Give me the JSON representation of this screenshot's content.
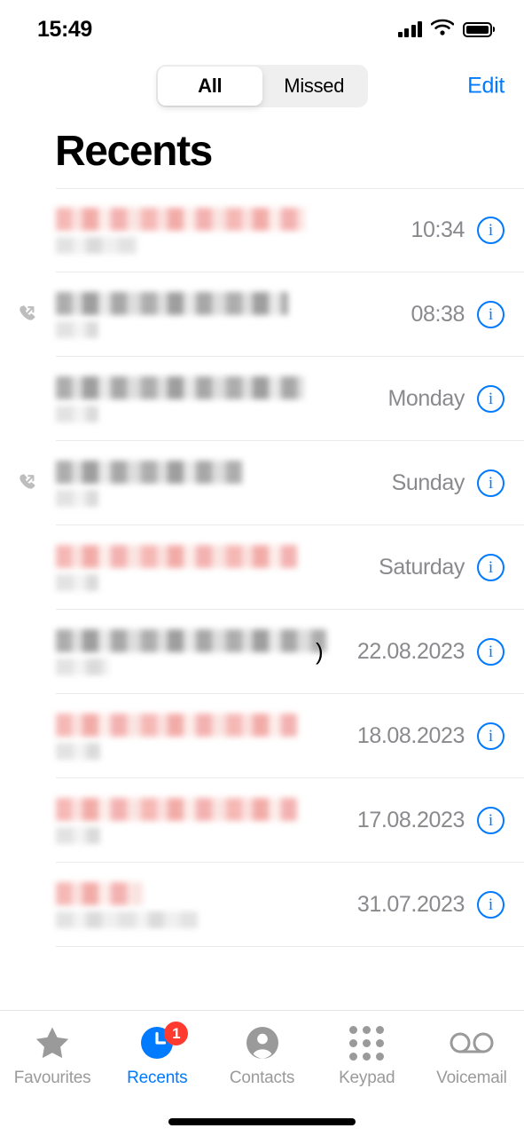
{
  "status_bar": {
    "time": "15:49",
    "cellular_icon": "signal-bars-icon",
    "wifi_icon": "wifi-icon",
    "battery_icon": "battery-full-icon"
  },
  "nav": {
    "segments": [
      {
        "label": "All",
        "selected": true
      },
      {
        "label": "Missed",
        "selected": false
      }
    ],
    "edit_label": "Edit"
  },
  "page": {
    "title": "Recents"
  },
  "calls": [
    {
      "timestamp": "10:34",
      "type": "missed",
      "direction": "incoming",
      "name_redacted": true,
      "sub_redacted": true,
      "extra_text": ""
    },
    {
      "timestamp": "08:38",
      "type": "outgoing",
      "direction": "outgoing",
      "name_redacted": true,
      "sub_redacted": true,
      "extra_text": ""
    },
    {
      "timestamp": "Monday",
      "type": "incoming",
      "direction": "incoming",
      "name_redacted": true,
      "sub_redacted": true,
      "extra_text": ""
    },
    {
      "timestamp": "Sunday",
      "type": "outgoing",
      "direction": "outgoing",
      "name_redacted": true,
      "sub_redacted": true,
      "extra_text": ""
    },
    {
      "timestamp": "Saturday",
      "type": "missed",
      "direction": "incoming",
      "name_redacted": true,
      "sub_redacted": true,
      "extra_text": ""
    },
    {
      "timestamp": "22.08.2023",
      "type": "incoming",
      "direction": "incoming",
      "name_redacted": true,
      "sub_redacted": true,
      "extra_text": ")"
    },
    {
      "timestamp": "18.08.2023",
      "type": "missed",
      "direction": "incoming",
      "name_redacted": true,
      "sub_redacted": true,
      "extra_text": ""
    },
    {
      "timestamp": "17.08.2023",
      "type": "missed",
      "direction": "incoming",
      "name_redacted": true,
      "sub_redacted": true,
      "extra_text": ""
    },
    {
      "timestamp": "31.07.2023",
      "type": "missed",
      "direction": "incoming",
      "name_redacted": true,
      "sub_redacted": true,
      "extra_text": ""
    }
  ],
  "info_button_label": "i",
  "tabs": [
    {
      "label": "Favourites",
      "icon": "star-icon",
      "active": false,
      "badge": ""
    },
    {
      "label": "Recents",
      "icon": "clock-icon",
      "active": true,
      "badge": "1"
    },
    {
      "label": "Contacts",
      "icon": "person-icon",
      "active": false,
      "badge": ""
    },
    {
      "label": "Keypad",
      "icon": "keypad-icon",
      "active": false,
      "badge": ""
    },
    {
      "label": "Voicemail",
      "icon": "voicemail-icon",
      "active": false,
      "badge": ""
    }
  ],
  "colors": {
    "accent": "#007AFF",
    "badge": "#FF3B30",
    "timestamp": "#8A8A8E",
    "tab_inactive": "#9A9A9A",
    "divider": "#EAEAEA",
    "segment_track": "#EFEFF0"
  }
}
